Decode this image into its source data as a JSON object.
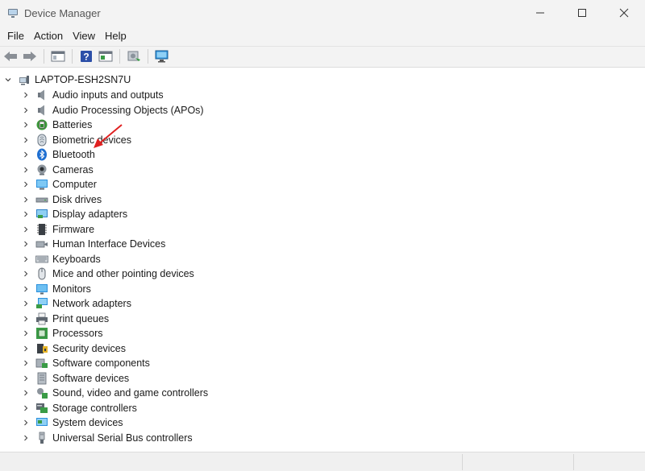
{
  "window": {
    "title": "Device Manager",
    "icon": "device-manager-icon",
    "controls": [
      "minimize-icon",
      "maximize-icon",
      "close-icon"
    ]
  },
  "menu": [
    "File",
    "Action",
    "View",
    "Help"
  ],
  "toolbar": [
    "back-arrow-icon",
    "forward-arrow-icon",
    "show-hide-console-tree-icon",
    "help-icon",
    "properties-icon",
    "update-driver-icon",
    "scan-hardware-icon"
  ],
  "tree": {
    "root": "LAPTOP-ESH2SN7U",
    "categories": [
      {
        "label": "Audio inputs and outputs",
        "icon": "speaker-icon"
      },
      {
        "label": "Audio Processing Objects (APOs)",
        "icon": "speaker-icon"
      },
      {
        "label": "Batteries",
        "icon": "battery-icon"
      },
      {
        "label": "Biometric devices",
        "icon": "fingerprint-icon"
      },
      {
        "label": "Bluetooth",
        "icon": "bluetooth-icon"
      },
      {
        "label": "Cameras",
        "icon": "camera-icon"
      },
      {
        "label": "Computer",
        "icon": "computer-icon"
      },
      {
        "label": "Disk drives",
        "icon": "disk-drive-icon"
      },
      {
        "label": "Display adapters",
        "icon": "display-adapter-icon"
      },
      {
        "label": "Firmware",
        "icon": "firmware-icon"
      },
      {
        "label": "Human Interface Devices",
        "icon": "hid-icon"
      },
      {
        "label": "Keyboards",
        "icon": "keyboard-icon"
      },
      {
        "label": "Mice and other pointing devices",
        "icon": "mouse-icon"
      },
      {
        "label": "Monitors",
        "icon": "monitor-icon"
      },
      {
        "label": "Network adapters",
        "icon": "network-adapter-icon"
      },
      {
        "label": "Print queues",
        "icon": "printer-icon"
      },
      {
        "label": "Processors",
        "icon": "processor-icon"
      },
      {
        "label": "Security devices",
        "icon": "security-device-icon"
      },
      {
        "label": "Software components",
        "icon": "software-component-icon"
      },
      {
        "label": "Software devices",
        "icon": "software-device-icon"
      },
      {
        "label": "Sound, video and game controllers",
        "icon": "sound-controller-icon"
      },
      {
        "label": "Storage controllers",
        "icon": "storage-controller-icon"
      },
      {
        "label": "System devices",
        "icon": "system-device-icon"
      },
      {
        "label": "Universal Serial Bus controllers",
        "icon": "usb-icon"
      }
    ]
  },
  "colors": {
    "annotation_arrow": "#e02020",
    "bluetooth": "#1f6fd1",
    "monitor_blue": "#2a8fdc"
  }
}
